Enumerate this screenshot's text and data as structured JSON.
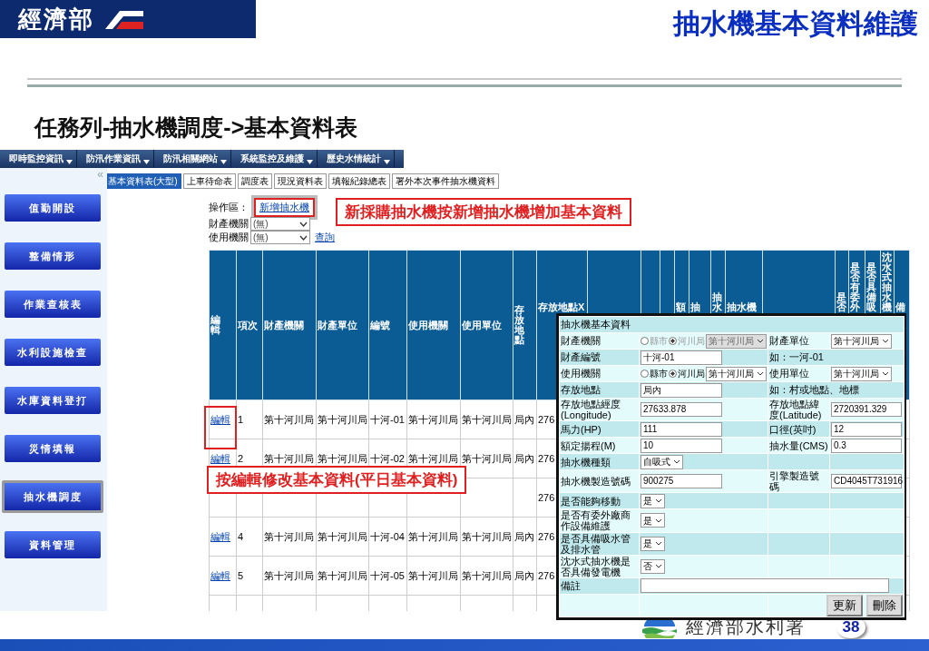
{
  "slide": {
    "logo": "經濟部",
    "title": "抽水機基本資料維護",
    "subtitle": "任務列-抽水機調度->基本資料表",
    "footer_org": "經濟部水利署",
    "page": "38"
  },
  "nav": [
    "即時監控資訊",
    "防汛作業資訊",
    "防汛相關網站",
    "系統監控及維護",
    "歷史水情統計"
  ],
  "sidebar": {
    "collapse": "«",
    "items": [
      {
        "label": "值勤開設",
        "selected": false
      },
      {
        "label": "整備情形",
        "selected": false
      },
      {
        "label": "作業查核表",
        "selected": false
      },
      {
        "label": "水利設施檢查",
        "selected": false
      },
      {
        "label": "水庫資料登打",
        "selected": false
      },
      {
        "label": "災情填報",
        "selected": false
      },
      {
        "label": "抽水機調度",
        "selected": true
      },
      {
        "label": "資料管理",
        "selected": false
      }
    ]
  },
  "tabs": [
    {
      "label": "基本資料表(大型)",
      "selected": true
    },
    {
      "label": "上車待命表",
      "selected": false
    },
    {
      "label": "調度表",
      "selected": false
    },
    {
      "label": "現況資料表",
      "selected": false
    },
    {
      "label": "填報紀錄總表",
      "selected": false
    },
    {
      "label": "署外本次事件抽水機資料",
      "selected": false
    }
  ],
  "toolbar": {
    "label": "操作區：",
    "add_link": "新增抽水機",
    "filters": [
      {
        "label": "財產機關",
        "value": "(無)"
      },
      {
        "label": "使用機關",
        "value": "(無)"
      }
    ],
    "query_link": "查詢"
  },
  "table": {
    "columns": [
      "編輯",
      "項次",
      "財產機關",
      "財產單位",
      "編號",
      "使用機關",
      "使用單位",
      "存放地點",
      "存放地點X",
      "",
      "",
      "",
      "額",
      "抽",
      "抽水",
      "抽水機",
      "",
      "是否",
      "是否有委外",
      "是否具備吸",
      "沈水式抽水機",
      "備"
    ],
    "rows": [
      {
        "cells": [
          "編輯",
          "1",
          "第十河川局",
          "第十河川局",
          "十河-01",
          "第十河川局",
          "第十河川局",
          "局內",
          "276"
        ]
      },
      {
        "cells": [
          "編輯",
          "2",
          "第十河川局",
          "第十河川局",
          "十河-02",
          "第十河川局",
          "第十河川局",
          "局內",
          "276"
        ]
      },
      {
        "cells": [
          "",
          "",
          "",
          "",
          "",
          "",
          "",
          "",
          "276"
        ]
      },
      {
        "cells": [
          "編輯",
          "4",
          "第十河川局",
          "第十河川局",
          "十河-04",
          "第十河川局",
          "第十河川局",
          "局內",
          "276"
        ]
      },
      {
        "cells": [
          "編輯",
          "5",
          "第十河川局",
          "第十河川局",
          "十河-05",
          "第十河川局",
          "第十河川局",
          "局內",
          "276"
        ]
      },
      {
        "cells": []
      }
    ]
  },
  "form": {
    "rows": [
      {
        "kind": "title",
        "label": "抽水機基本資料"
      },
      {
        "kind": "fields",
        "label": "財產機關",
        "left": {
          "kind": "radios",
          "disabled": true,
          "options": [
            {
              "label": "縣市",
              "selected": false
            },
            {
              "label": "河川局",
              "selected": true
            }
          ],
          "select": "第十河川局"
        },
        "label2": "財產單位",
        "right": {
          "kind": "select",
          "value": "第十河川局"
        }
      },
      {
        "kind": "fields",
        "label": "財產編號",
        "left": {
          "kind": "input",
          "value": "十河-01"
        },
        "note": "如：一河-01"
      },
      {
        "kind": "fields",
        "label": "使用機關",
        "left": {
          "kind": "radios",
          "disabled": false,
          "options": [
            {
              "label": "縣市",
              "selected": false
            },
            {
              "label": "河川局",
              "selected": true
            }
          ],
          "select": "第十河川局"
        },
        "label2": "使用單位",
        "right": {
          "kind": "select",
          "value": "第十河川局"
        }
      },
      {
        "kind": "fields",
        "label": "存放地點",
        "left": {
          "kind": "input",
          "value": "局內"
        },
        "note": "如：村或地點、地標"
      },
      {
        "kind": "fields",
        "label": "存放地點經度(Longitude)",
        "left": {
          "kind": "input",
          "value": "27633.878"
        },
        "label2": "存放地點緯度(Latitude)",
        "right": {
          "kind": "input",
          "value": "2720391.329"
        }
      },
      {
        "kind": "fields",
        "label": "馬力(HP)",
        "left": {
          "kind": "input",
          "value": "111"
        },
        "label2": "口徑(英吋)",
        "right": {
          "kind": "input",
          "value": "12"
        }
      },
      {
        "kind": "fields",
        "label": "額定揚程(M)",
        "left": {
          "kind": "input",
          "value": "10"
        },
        "label2": "抽水量(CMS)",
        "right": {
          "kind": "input",
          "value": "0.3"
        }
      },
      {
        "kind": "fields",
        "label": "抽水機種類",
        "left": {
          "kind": "select",
          "value": "自吸式"
        }
      },
      {
        "kind": "fields",
        "label": "抽水機製造號碼",
        "left": {
          "kind": "input",
          "value": "900275"
        },
        "label2": "引擎製造號碼",
        "right": {
          "kind": "input",
          "value": "CD4045T731916"
        }
      },
      {
        "kind": "fields",
        "label": "是否能夠移動",
        "left": {
          "kind": "select",
          "value": "是"
        }
      },
      {
        "kind": "fields",
        "label": "是否有委外廠商作設備維護",
        "left": {
          "kind": "select",
          "value": "是"
        }
      },
      {
        "kind": "fields",
        "label": "是否具備吸水管及排水管",
        "left": {
          "kind": "select",
          "value": "是"
        }
      },
      {
        "kind": "fields",
        "label": "沈水式抽水機是否具備發電機",
        "left": {
          "kind": "select",
          "value": "否"
        }
      },
      {
        "kind": "remark",
        "label": "備註"
      },
      {
        "kind": "buttons",
        "buttons": [
          "更新",
          "刪除"
        ]
      }
    ]
  },
  "annotations": [
    "新採購抽水機按新增抽水機增加基本資料",
    "按編輯修改基本資料(平日基本資料)"
  ]
}
